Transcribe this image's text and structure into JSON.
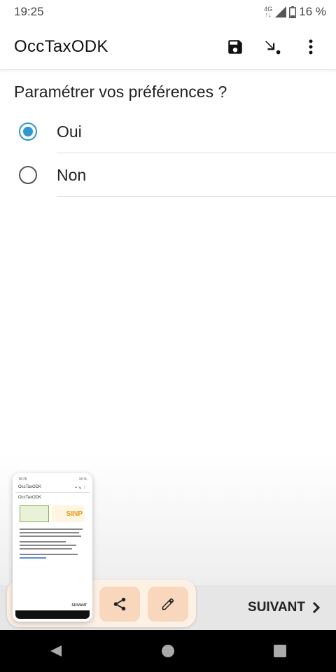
{
  "status_bar": {
    "time": "19:25",
    "network": "4G",
    "battery": "16 %"
  },
  "app_bar": {
    "title": "OccTaxODK",
    "icons": [
      "save-icon",
      "jump-icon",
      "more-vert-icon"
    ]
  },
  "question": {
    "label": "Paramétrer vos préférences ?",
    "options": [
      {
        "label": "Oui",
        "selected": true
      },
      {
        "label": "Non",
        "selected": false
      }
    ]
  },
  "bottom_bar": {
    "next_label": "SUIVANT"
  },
  "thumbnail": {
    "time": "19:25",
    "battery": "16 %",
    "title": "OccTaxODK",
    "logo_text": "SINP",
    "next_label": "SUIVANT"
  },
  "share_tray": {
    "icons": [
      "share-icon",
      "edit-icon"
    ]
  },
  "nav_bar": {
    "icons": [
      "back-icon",
      "home-icon",
      "recents-icon"
    ]
  },
  "colors": {
    "accent": "#2f97d2",
    "tray": "#fdf1e6",
    "tray_button": "#f8d7bd"
  }
}
